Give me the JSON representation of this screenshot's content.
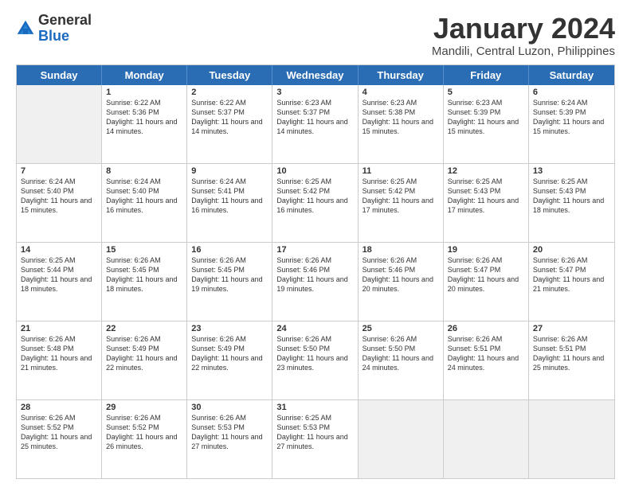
{
  "logo": {
    "general": "General",
    "blue": "Blue"
  },
  "title": "January 2024",
  "subtitle": "Mandili, Central Luzon, Philippines",
  "days": [
    "Sunday",
    "Monday",
    "Tuesday",
    "Wednesday",
    "Thursday",
    "Friday",
    "Saturday"
  ],
  "weeks": [
    [
      {
        "day": "",
        "sunrise": "",
        "sunset": "",
        "daylight": "",
        "empty": true
      },
      {
        "day": "1",
        "sunrise": "Sunrise: 6:22 AM",
        "sunset": "Sunset: 5:36 PM",
        "daylight": "Daylight: 11 hours and 14 minutes."
      },
      {
        "day": "2",
        "sunrise": "Sunrise: 6:22 AM",
        "sunset": "Sunset: 5:37 PM",
        "daylight": "Daylight: 11 hours and 14 minutes."
      },
      {
        "day": "3",
        "sunrise": "Sunrise: 6:23 AM",
        "sunset": "Sunset: 5:37 PM",
        "daylight": "Daylight: 11 hours and 14 minutes."
      },
      {
        "day": "4",
        "sunrise": "Sunrise: 6:23 AM",
        "sunset": "Sunset: 5:38 PM",
        "daylight": "Daylight: 11 hours and 15 minutes."
      },
      {
        "day": "5",
        "sunrise": "Sunrise: 6:23 AM",
        "sunset": "Sunset: 5:39 PM",
        "daylight": "Daylight: 11 hours and 15 minutes."
      },
      {
        "day": "6",
        "sunrise": "Sunrise: 6:24 AM",
        "sunset": "Sunset: 5:39 PM",
        "daylight": "Daylight: 11 hours and 15 minutes."
      }
    ],
    [
      {
        "day": "7",
        "sunrise": "Sunrise: 6:24 AM",
        "sunset": "Sunset: 5:40 PM",
        "daylight": "Daylight: 11 hours and 15 minutes."
      },
      {
        "day": "8",
        "sunrise": "Sunrise: 6:24 AM",
        "sunset": "Sunset: 5:40 PM",
        "daylight": "Daylight: 11 hours and 16 minutes."
      },
      {
        "day": "9",
        "sunrise": "Sunrise: 6:24 AM",
        "sunset": "Sunset: 5:41 PM",
        "daylight": "Daylight: 11 hours and 16 minutes."
      },
      {
        "day": "10",
        "sunrise": "Sunrise: 6:25 AM",
        "sunset": "Sunset: 5:42 PM",
        "daylight": "Daylight: 11 hours and 16 minutes."
      },
      {
        "day": "11",
        "sunrise": "Sunrise: 6:25 AM",
        "sunset": "Sunset: 5:42 PM",
        "daylight": "Daylight: 11 hours and 17 minutes."
      },
      {
        "day": "12",
        "sunrise": "Sunrise: 6:25 AM",
        "sunset": "Sunset: 5:43 PM",
        "daylight": "Daylight: 11 hours and 17 minutes."
      },
      {
        "day": "13",
        "sunrise": "Sunrise: 6:25 AM",
        "sunset": "Sunset: 5:43 PM",
        "daylight": "Daylight: 11 hours and 18 minutes."
      }
    ],
    [
      {
        "day": "14",
        "sunrise": "Sunrise: 6:25 AM",
        "sunset": "Sunset: 5:44 PM",
        "daylight": "Daylight: 11 hours and 18 minutes."
      },
      {
        "day": "15",
        "sunrise": "Sunrise: 6:26 AM",
        "sunset": "Sunset: 5:45 PM",
        "daylight": "Daylight: 11 hours and 18 minutes."
      },
      {
        "day": "16",
        "sunrise": "Sunrise: 6:26 AM",
        "sunset": "Sunset: 5:45 PM",
        "daylight": "Daylight: 11 hours and 19 minutes."
      },
      {
        "day": "17",
        "sunrise": "Sunrise: 6:26 AM",
        "sunset": "Sunset: 5:46 PM",
        "daylight": "Daylight: 11 hours and 19 minutes."
      },
      {
        "day": "18",
        "sunrise": "Sunrise: 6:26 AM",
        "sunset": "Sunset: 5:46 PM",
        "daylight": "Daylight: 11 hours and 20 minutes."
      },
      {
        "day": "19",
        "sunrise": "Sunrise: 6:26 AM",
        "sunset": "Sunset: 5:47 PM",
        "daylight": "Daylight: 11 hours and 20 minutes."
      },
      {
        "day": "20",
        "sunrise": "Sunrise: 6:26 AM",
        "sunset": "Sunset: 5:47 PM",
        "daylight": "Daylight: 11 hours and 21 minutes."
      }
    ],
    [
      {
        "day": "21",
        "sunrise": "Sunrise: 6:26 AM",
        "sunset": "Sunset: 5:48 PM",
        "daylight": "Daylight: 11 hours and 21 minutes."
      },
      {
        "day": "22",
        "sunrise": "Sunrise: 6:26 AM",
        "sunset": "Sunset: 5:49 PM",
        "daylight": "Daylight: 11 hours and 22 minutes."
      },
      {
        "day": "23",
        "sunrise": "Sunrise: 6:26 AM",
        "sunset": "Sunset: 5:49 PM",
        "daylight": "Daylight: 11 hours and 22 minutes."
      },
      {
        "day": "24",
        "sunrise": "Sunrise: 6:26 AM",
        "sunset": "Sunset: 5:50 PM",
        "daylight": "Daylight: 11 hours and 23 minutes."
      },
      {
        "day": "25",
        "sunrise": "Sunrise: 6:26 AM",
        "sunset": "Sunset: 5:50 PM",
        "daylight": "Daylight: 11 hours and 24 minutes."
      },
      {
        "day": "26",
        "sunrise": "Sunrise: 6:26 AM",
        "sunset": "Sunset: 5:51 PM",
        "daylight": "Daylight: 11 hours and 24 minutes."
      },
      {
        "day": "27",
        "sunrise": "Sunrise: 6:26 AM",
        "sunset": "Sunset: 5:51 PM",
        "daylight": "Daylight: 11 hours and 25 minutes."
      }
    ],
    [
      {
        "day": "28",
        "sunrise": "Sunrise: 6:26 AM",
        "sunset": "Sunset: 5:52 PM",
        "daylight": "Daylight: 11 hours and 25 minutes."
      },
      {
        "day": "29",
        "sunrise": "Sunrise: 6:26 AM",
        "sunset": "Sunset: 5:52 PM",
        "daylight": "Daylight: 11 hours and 26 minutes."
      },
      {
        "day": "30",
        "sunrise": "Sunrise: 6:26 AM",
        "sunset": "Sunset: 5:53 PM",
        "daylight": "Daylight: 11 hours and 27 minutes."
      },
      {
        "day": "31",
        "sunrise": "Sunrise: 6:25 AM",
        "sunset": "Sunset: 5:53 PM",
        "daylight": "Daylight: 11 hours and 27 minutes."
      },
      {
        "day": "",
        "sunrise": "",
        "sunset": "",
        "daylight": "",
        "empty": true
      },
      {
        "day": "",
        "sunrise": "",
        "sunset": "",
        "daylight": "",
        "empty": true
      },
      {
        "day": "",
        "sunrise": "",
        "sunset": "",
        "daylight": "",
        "empty": true
      }
    ]
  ]
}
